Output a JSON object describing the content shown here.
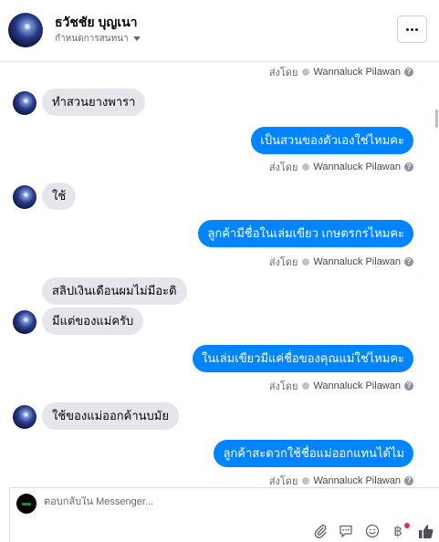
{
  "header": {
    "contact_name": "ธวัชชัย บุญเนา",
    "conversation_settings": "กำหนดการสนทนา",
    "more_label": "···"
  },
  "sent_by_prefix": "ส่งโดย",
  "sent_by_name": "Wannaluck Pilawan",
  "info_glyph": "?",
  "messages": [
    {
      "dir": "in",
      "text": "ทำสวนยางพารา"
    },
    {
      "dir": "out",
      "text": "เป็นสวนของตัวเองใช่ไหมคะ"
    },
    {
      "dir": "in",
      "text": "ใช้"
    },
    {
      "dir": "out",
      "text": "ลูกค้ามีชื่อในเล่มเขียว เกษตรกรไหมคะ"
    },
    {
      "dir": "in",
      "text": "สลิปเงินเดือนผมไม่มีอะดิ"
    },
    {
      "dir": "in",
      "text": "มีแต่ของแม่ครับ"
    },
    {
      "dir": "out",
      "text": "ในเล่มเขียวมีแค่ชื่อของคุณแม่ใช่ไหมคะ"
    },
    {
      "dir": "in",
      "text": "ใช้ของแม่ออกค้านบมัย"
    },
    {
      "dir": "out",
      "text": "ลูกค้าสะดวกใช้ชื่อแม่ออกแทนได้ไม"
    }
  ],
  "composer": {
    "placeholder": "ตอบกลับใน Messenger...",
    "baht_glyph": "฿"
  },
  "colors": {
    "outgoing_bubble": "#0084ff",
    "incoming_bubble": "#e4e6eb",
    "muted_text": "#65676b",
    "like_icon": "#4b4f56"
  },
  "icons": [
    "attachment-icon",
    "saved-replies-icon",
    "emoji-icon",
    "baht-icon",
    "like-icon",
    "more-icon"
  ]
}
